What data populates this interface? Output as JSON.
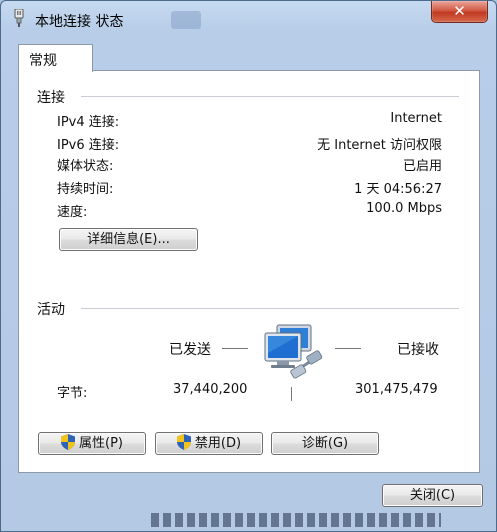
{
  "window": {
    "title": "本地连接 状态"
  },
  "tab": {
    "label": "常规"
  },
  "connection": {
    "heading": "连接",
    "rows": [
      {
        "label": "IPv4 连接:",
        "value": "Internet"
      },
      {
        "label": "IPv6 连接:",
        "value": "无 Internet 访问权限"
      },
      {
        "label": "媒体状态:",
        "value": "已启用"
      },
      {
        "label": "持续时间:",
        "value": "1 天 04:56:27"
      },
      {
        "label": "速度:",
        "value": "100.0 Mbps"
      }
    ],
    "details_button": "详细信息(E)..."
  },
  "activity": {
    "heading": "活动",
    "sent_label": "已发送",
    "received_label": "已接收",
    "bytes_label": "字节:",
    "bytes_sent": "37,440,200",
    "bytes_received": "301,475,479"
  },
  "buttons": {
    "properties": "属性(P)",
    "disable": "禁用(D)",
    "diagnose": "诊断(G)",
    "close": "关闭(C)"
  },
  "icons": {
    "title": "network-adapter-icon",
    "network": "network-computers-icon",
    "shield": "uac-shield-icon",
    "close": "close-icon"
  }
}
